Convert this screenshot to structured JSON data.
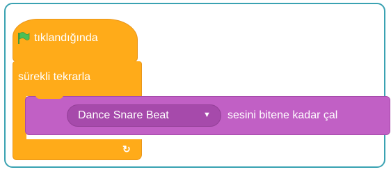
{
  "hat_block": {
    "label": "tıklandığında",
    "icon": "green-flag-icon"
  },
  "forever_block": {
    "label": "sürekli tekrarla",
    "loop_icon": "↻"
  },
  "sound_block": {
    "sound_name": "Dance Snare Beat",
    "dropdown_arrow": "▼",
    "action_text": "sesini bitene kadar çal"
  },
  "colors": {
    "events": "#ffab19",
    "sound": "#c160c5",
    "sound_dropdown": "#a64aab",
    "flag": "#4cbf56",
    "frame": "#3aa2b2"
  }
}
